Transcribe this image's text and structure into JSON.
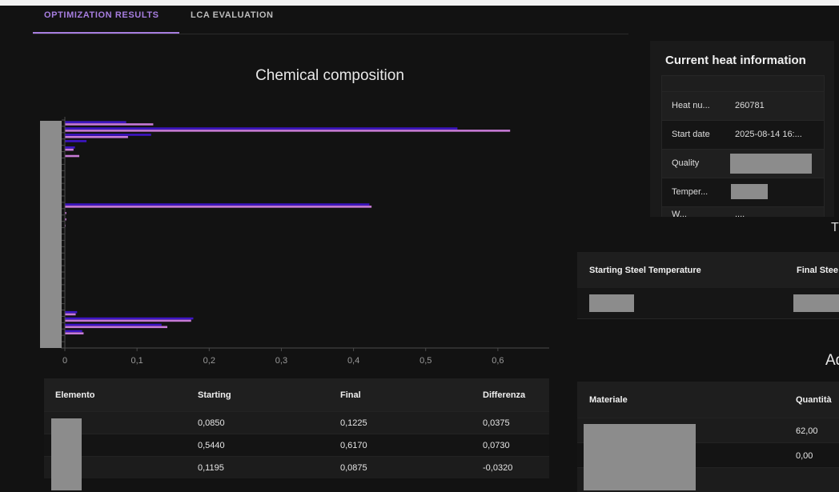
{
  "tabs": [
    {
      "label": "OPTIMIZATION RESULTS",
      "active": true
    },
    {
      "label": "LCA EVALUATION",
      "active": false
    }
  ],
  "colors": {
    "accent": "#a77ee0",
    "starting_series": "#3d15c4",
    "final_series": "#c77ad6"
  },
  "chart_data": {
    "type": "bar",
    "orientation": "horizontal",
    "title": "Chemical composition",
    "xlabel": "",
    "ylabel": "",
    "categories": [
      "",
      "",
      "",
      "",
      "",
      "",
      "",
      "",
      "",
      "",
      "",
      "",
      "",
      "",
      "",
      "",
      "",
      "",
      "",
      "",
      "",
      "",
      "",
      "",
      "",
      "",
      "",
      "",
      "",
      "",
      "",
      "",
      "",
      "",
      "",
      ""
    ],
    "x_ticks": [
      "0",
      "0,1",
      "0,2",
      "0,3",
      "0,4",
      "0,5",
      "0,6"
    ],
    "xlim": [
      0,
      0.68
    ],
    "grid": false,
    "series": [
      {
        "values": [
          0.085,
          0.544,
          0.1195,
          0.03,
          0.014,
          0.0,
          0.0,
          0.0,
          0.0,
          0.0,
          0.0,
          0.0,
          0.0,
          0.422,
          0.0,
          0.0,
          0.0,
          0.0,
          0.0,
          0.0,
          0.0,
          0.0,
          0.0,
          0.0,
          0.0,
          0.0,
          0.0,
          0.0,
          0.0,
          0.0,
          0.017,
          0.178,
          0.134,
          0.024,
          0.0,
          0.0
        ]
      },
      {
        "values": [
          0.1225,
          0.617,
          0.0875,
          0.0,
          0.012,
          0.02,
          0.0,
          0.0,
          0.0,
          0.0,
          0.0,
          0.0,
          0.0,
          0.425,
          0.002,
          0.002,
          0.001,
          0.0,
          0.0,
          0.0,
          0.0,
          0.0,
          0.0,
          0.0,
          0.0,
          0.0,
          0.0,
          0.0,
          0.0,
          0.0,
          0.015,
          0.175,
          0.142,
          0.026,
          0.0,
          0.0
        ]
      }
    ]
  },
  "composition_table": {
    "headers": [
      "Elemento",
      "Starting",
      "Final",
      "Differenza"
    ],
    "rows": [
      {
        "starting": "0,0850",
        "final": "0,1225",
        "diff": "0,0375"
      },
      {
        "starting": "0,5440",
        "final": "0,6170",
        "diff": "0,0730"
      },
      {
        "starting": "0,1195",
        "final": "0,0875",
        "diff": "-0,0320"
      }
    ]
  },
  "heat_info": {
    "title": "Current heat information",
    "rows": [
      {
        "label": "Heat nu...",
        "value": "260781"
      },
      {
        "label": "Start date",
        "value": "2025-08-14 16:..."
      },
      {
        "label": "Quality",
        "value": ""
      },
      {
        "label": "Temper...",
        "value": ""
      },
      {
        "label": "W...",
        "value": "...."
      }
    ]
  },
  "temperature_table": {
    "glyph": "T",
    "headers": [
      "Starting Steel Temperature",
      "Final Stee"
    ]
  },
  "materials": {
    "glyph": "Ad",
    "headers": [
      "Materiale",
      "Quantità"
    ],
    "rows": [
      {
        "quantity": "62,00"
      },
      {
        "quantity": "0,00"
      }
    ]
  }
}
